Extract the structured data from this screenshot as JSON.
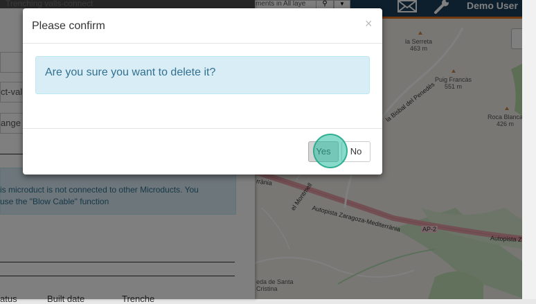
{
  "topbar": {
    "user_name": "Demo User",
    "layers_search_placeholder": "ments in All laye",
    "search_icon": "magnifier-icon",
    "caret_icon": "chevron-down-icon"
  },
  "panel": {
    "header_text": "Trenching  valls-connect",
    "fields": [
      "",
      "ct-valls",
      "ange"
    ],
    "info_line1": "is microduct is not connected to other Microducts. You",
    "info_line2": "use the \"Blow Cable\" function",
    "columns": [
      "atus",
      "Built date",
      "Trenche"
    ]
  },
  "map": {
    "labels": [
      {
        "name": "la Serreta",
        "alt": "463 m"
      },
      {
        "name": "Puig Francàs",
        "alt": "551 m"
      },
      {
        "name": "Roca Blanca",
        "alt": "426 m"
      }
    ],
    "roads": [
      "la Bisbal del Penedès",
      "Autopista Zaragoza-Mediterrània",
      "AP-2",
      "Autopista Z",
      "el Montmell",
      "rrània"
    ],
    "places": [
      "eda de Santa",
      "Cristina"
    ]
  },
  "modal": {
    "title": "Please confirm",
    "close_symbol": "×",
    "message": "Are you sure you want to delete it?",
    "yes_label": "Yes",
    "no_label": "No"
  },
  "colors": {
    "topbar": "#1b3f5a",
    "accent": "#e4701e",
    "alert_bg": "#d9edf7",
    "alert_text": "#31708f",
    "click_marker": "#26bea0"
  }
}
